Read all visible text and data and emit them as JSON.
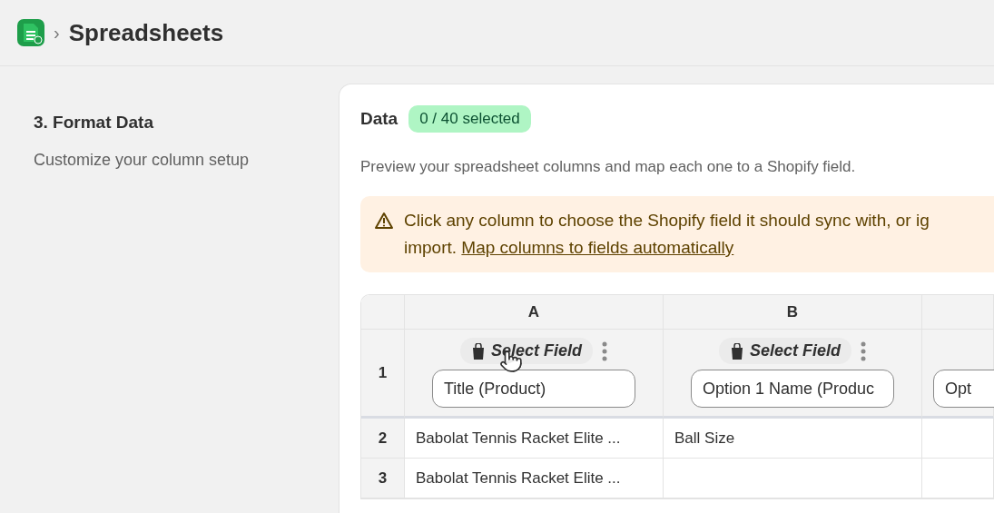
{
  "breadcrumb": {
    "separator": "›",
    "title": "Spreadsheets"
  },
  "step": {
    "title": "3. Format Data",
    "subtitle": "Customize your column setup"
  },
  "data_card": {
    "title": "Data",
    "badge": "0 / 40 selected",
    "description": "Preview your spreadsheet columns and map each one to a Shopify field.",
    "alert": {
      "text": "Click any column to choose the Shopify field it should sync with, or ig",
      "text_2": "import. ",
      "link": "Map columns to fields automatically"
    },
    "table": {
      "columns": [
        {
          "letter": "A",
          "select_label": "Select Field",
          "field": "Title (Product)"
        },
        {
          "letter": "B",
          "select_label": "Select Field",
          "field": "Option 1 Name (Produc"
        },
        {
          "field": "Opt"
        }
      ],
      "header_row_number": "1",
      "rows": [
        {
          "number": "2",
          "cells": [
            "Babolat Tennis Racket Elite ...",
            "Ball Size",
            ""
          ]
        },
        {
          "number": "3",
          "cells": [
            "Babolat Tennis Racket Elite ...",
            "",
            ""
          ]
        }
      ]
    }
  }
}
